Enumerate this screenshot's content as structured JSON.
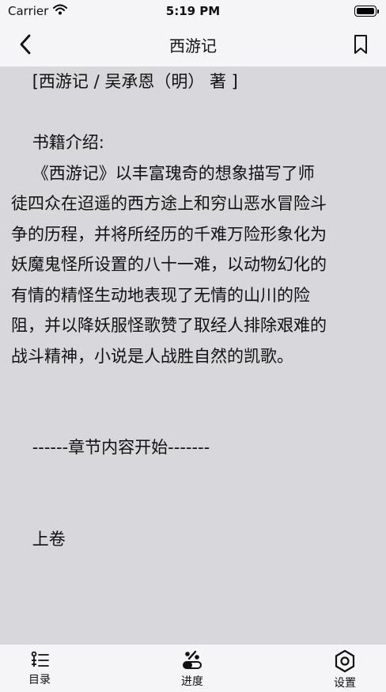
{
  "status_bar": {
    "carrier": "Carrier",
    "time": "5:19 PM"
  },
  "nav": {
    "title": "西游记",
    "back_icon": "chevron-left-icon",
    "bookmark_icon": "bookmark-icon"
  },
  "content": {
    "lines": [
      "    [西游记 / 吴承恩（明） 著 ]",
      "",
      "    书籍介绍:",
      "    《西游记》以丰富瑰奇的想象描写了师",
      "徒四众在迢遥的西方途上和穷山恶水冒险斗",
      "争的历程，并将所经历的千难万险形象化为",
      "妖魔鬼怪所设置的八十一难，以动物幻化的",
      "有情的精怪生动地表现了无情的山川的险",
      "阻，并以降妖服怪歌赞了取经人排除艰难的",
      "战斗精神，小说是人战胜自然的凯歌。",
      "",
      "    ------章节内容开始-------",
      "",
      "    上卷"
    ]
  },
  "tab_bar": {
    "items": [
      {
        "label": "目录",
        "icon": "list-icon"
      },
      {
        "label": "进度",
        "icon": "progress-icon"
      },
      {
        "label": "设置",
        "icon": "settings-hexagon-icon"
      }
    ]
  },
  "colors": {
    "page_background": "#d8d8dc",
    "bar_background": "#f5f5f7",
    "text": "#111111"
  }
}
